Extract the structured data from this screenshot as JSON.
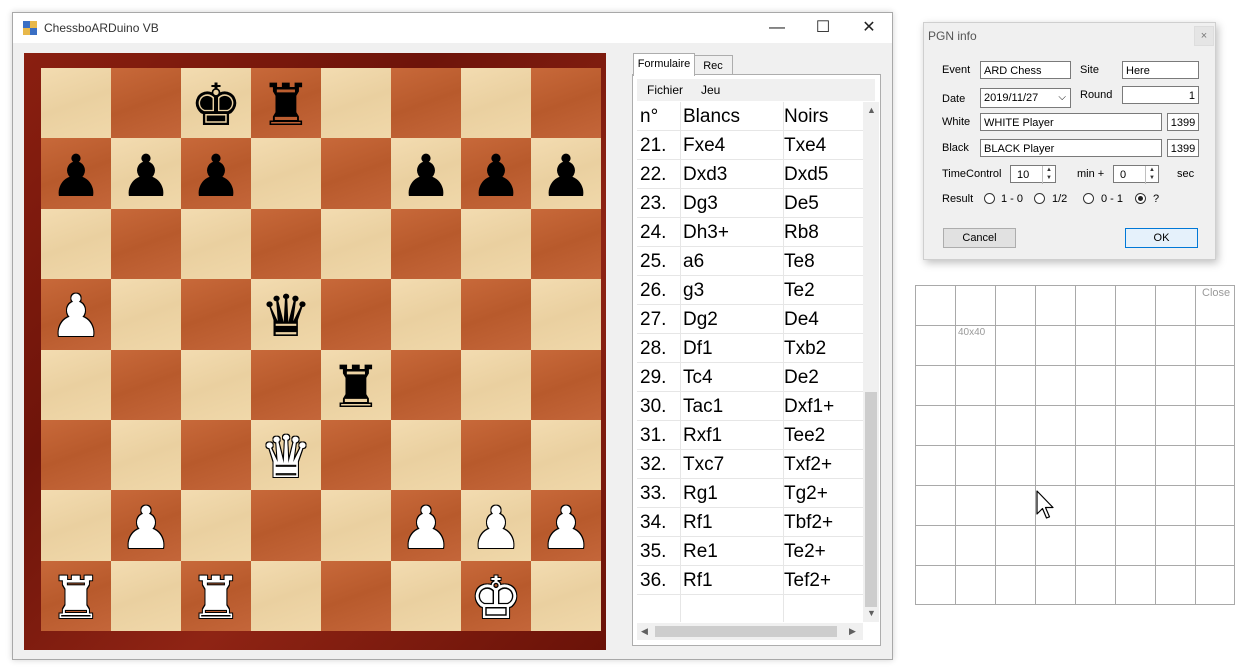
{
  "window": {
    "title": "ChessboARDuino VB",
    "minimize": "—",
    "maximize": "☐",
    "close": "✕"
  },
  "board": {
    "ranks": [
      [
        "",
        "",
        "bk",
        "br",
        "",
        "",
        "",
        ""
      ],
      [
        "bp",
        "bp",
        "bp",
        "",
        "",
        "bp",
        "bp",
        "bp"
      ],
      [
        "",
        "",
        "",
        "",
        "",
        "",
        "",
        ""
      ],
      [
        "wp",
        "",
        "",
        "bq",
        "",
        "",
        "",
        ""
      ],
      [
        "",
        "",
        "",
        "",
        "br",
        "",
        "",
        ""
      ],
      [
        "",
        "",
        "",
        "wq",
        "",
        "",
        "",
        ""
      ],
      [
        "",
        "wp",
        "",
        "",
        "",
        "wp",
        "wp",
        "wp"
      ],
      [
        "wr",
        "",
        "wr",
        "",
        "",
        "",
        "wk",
        ""
      ]
    ]
  },
  "tabs": {
    "formulaire": "Formulaire",
    "rec": "Rec"
  },
  "menu": {
    "fichier": "Fichier",
    "jeu": "Jeu"
  },
  "moves": {
    "headers": [
      "n°",
      "Blancs",
      "Noirs"
    ],
    "rows": [
      [
        "21.",
        "Fxe4",
        "Txe4"
      ],
      [
        "22.",
        "Dxd3",
        "Dxd5"
      ],
      [
        "23.",
        "Dg3",
        "De5"
      ],
      [
        "24.",
        "Dh3+",
        "Rb8"
      ],
      [
        "25.",
        "a6",
        "Te8"
      ],
      [
        "26.",
        "g3",
        "Te2"
      ],
      [
        "27.",
        "Dg2",
        "De4"
      ],
      [
        "28.",
        "Df1",
        "Txb2"
      ],
      [
        "29.",
        "Tc4",
        "De2"
      ],
      [
        "30.",
        "Tac1",
        "Dxf1+"
      ],
      [
        "31.",
        "Rxf1",
        "Tee2"
      ],
      [
        "32.",
        "Txc7",
        "Txf2+"
      ],
      [
        "33.",
        "Rg1",
        "Tg2+"
      ],
      [
        "34.",
        "Rf1",
        "Tbf2+"
      ],
      [
        "35.",
        "Re1",
        "Te2+"
      ],
      [
        "36.",
        "Rf1",
        "Tef2+"
      ],
      [
        "",
        "",
        ""
      ]
    ]
  },
  "pgn": {
    "title": "PGN info",
    "close": "×",
    "labels": {
      "event": "Event",
      "site": "Site",
      "date": "Date",
      "round": "Round",
      "white": "White",
      "black": "Black",
      "timecontrol": "TimeControl",
      "min_plus": "min +",
      "sec": "sec",
      "result": "Result"
    },
    "values": {
      "event": "ARD Chess",
      "site": "Here",
      "date": "2019/11/27",
      "round": "1",
      "white": "WHITE Player",
      "white_elo": "1399",
      "black": "BLACK Player",
      "black_elo": "1399",
      "minutes": "10",
      "seconds": "0"
    },
    "results": [
      {
        "label": "1 - 0",
        "selected": false
      },
      {
        "label": "1/2",
        "selected": false
      },
      {
        "label": "0 - 1",
        "selected": false
      },
      {
        "label": "?",
        "selected": true
      }
    ],
    "cancel": "Cancel",
    "ok": "OK"
  },
  "grid_panel": {
    "close": "Close",
    "cell_size": "40x40"
  },
  "colors": {
    "accent": "#0078d7",
    "board_light": "#ecd3a5",
    "board_dark": "#c0623a",
    "frame": "#7a180c"
  }
}
